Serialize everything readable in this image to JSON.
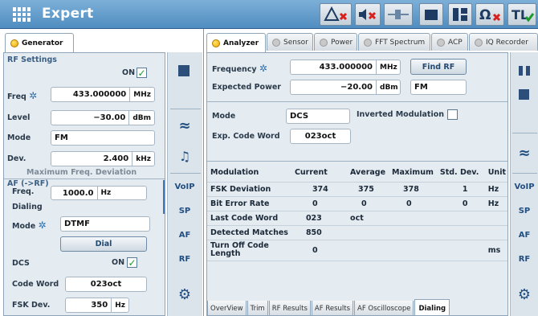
{
  "app": {
    "title": "Expert"
  },
  "toolbar": {
    "icons": [
      "delta-marker-off-icon",
      "mute-off-icon",
      "slider-icon",
      "folder-icon",
      "layout-icon",
      "ohm-off-icon",
      "tl-on-icon"
    ]
  },
  "generator": {
    "tab": "Generator",
    "rf_settings": "RF Settings",
    "on_label": "ON",
    "freq": {
      "label": "Freq",
      "value": "433.000000",
      "unit": "MHz"
    },
    "level": {
      "label": "Level",
      "value": "−30.00",
      "unit": "dBm"
    },
    "mode": {
      "label": "Mode",
      "value": "FM"
    },
    "dev": {
      "label": "Dev.",
      "value": "2.400",
      "unit": "kHz"
    },
    "max_dev_note": "Maximum Freq. Deviation",
    "af_rf": "AF (->RF)",
    "af_freq": {
      "label": "Freq.",
      "value": "1000.0",
      "unit": "Hz"
    },
    "dialing": "Dialing",
    "dial_mode": {
      "label": "Mode",
      "value": "DTMF"
    },
    "dial_button": "Dial",
    "dcs": {
      "label": "DCS",
      "state": "ON"
    },
    "code_word": {
      "label": "Code Word",
      "value": "023oct"
    },
    "fsk_dev": {
      "label": "FSK Dev.",
      "value": "350",
      "unit": "Hz"
    }
  },
  "gen_side": [
    "VoIP",
    "SP",
    "AF",
    "RF"
  ],
  "analyzer": {
    "tabs": [
      "Analyzer",
      "Sensor",
      "Power",
      "FFT Spectrum",
      "ACP",
      "IQ Recorder"
    ],
    "frequency": {
      "label": "Frequency",
      "value": "433.000000",
      "unit": "MHz"
    },
    "find_rf": "Find RF",
    "expected_power": {
      "label": "Expected Power",
      "value": "−20.00",
      "unit": "dBm"
    },
    "demod": "FM",
    "mode": {
      "label": "Mode",
      "value": "DCS"
    },
    "inverted": "Inverted Modulation",
    "exp_code": {
      "label": "Exp. Code Word",
      "value": "023oct"
    },
    "table": {
      "headers": [
        "Modulation",
        "Current",
        "Average",
        "Maximum",
        "Std. Dev.",
        "Unit"
      ],
      "rows": [
        [
          "FSK Deviation",
          "374",
          "375",
          "378",
          "1",
          "Hz"
        ],
        [
          "Bit Error Rate",
          "0",
          "0",
          "0",
          "0",
          "Hz"
        ],
        [
          "Last Code Word",
          "023",
          "oct",
          "",
          "",
          ""
        ],
        [
          "Detected Matches",
          "850",
          "",
          "",
          "",
          ""
        ],
        [
          "Turn Off Code Length",
          "0",
          "",
          "",
          "",
          "ms"
        ]
      ]
    },
    "bottom_tabs": [
      "OverView",
      "Trim",
      "RF Results",
      "AF Results",
      "AF Oscilloscope",
      "Dialing"
    ],
    "side": [
      "VoIP",
      "SP",
      "AF",
      "RF"
    ]
  },
  "colors": {
    "title_bar": "#5b97c8",
    "accent": "#2f6fa8",
    "check": "#1d9a2c",
    "panel": "#e4ebf1"
  }
}
